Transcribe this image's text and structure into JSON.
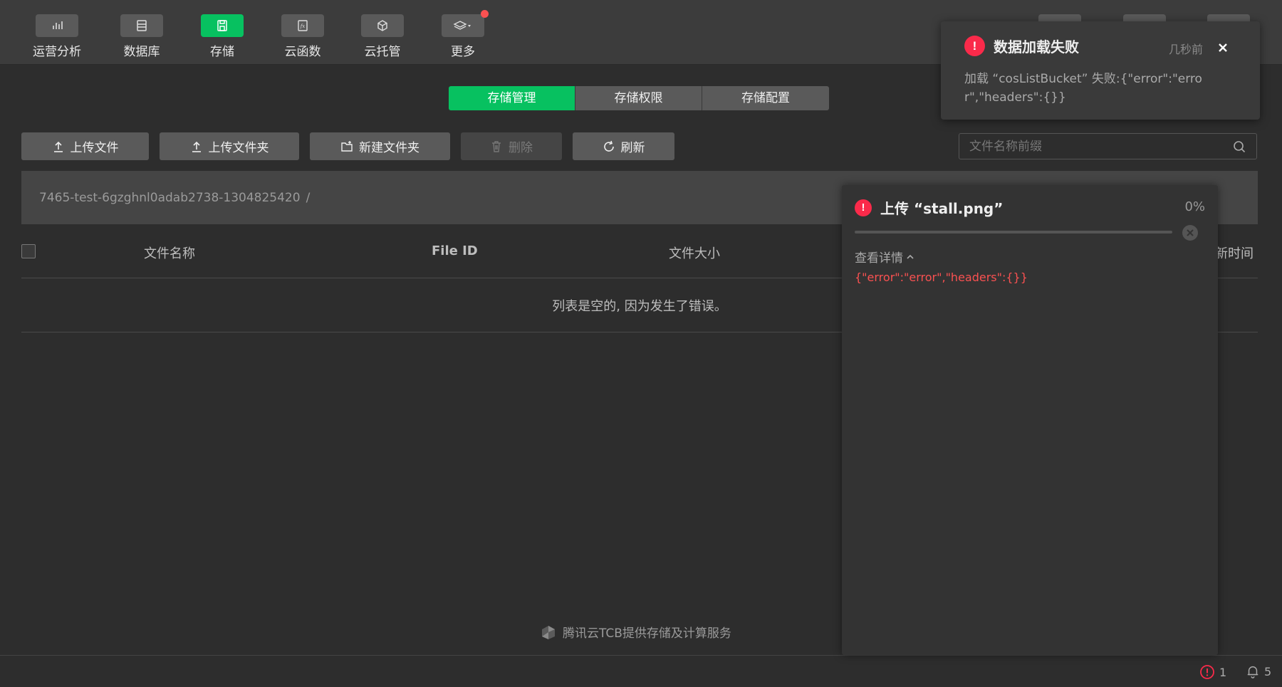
{
  "nav": {
    "items": [
      {
        "label": "运营分析",
        "icon": "bar-chart-icon",
        "active": false
      },
      {
        "label": "数据库",
        "icon": "database-icon",
        "active": false
      },
      {
        "label": "存储",
        "icon": "save-icon",
        "active": true
      },
      {
        "label": "云函数",
        "icon": "function-icon",
        "active": false
      },
      {
        "label": "云托管",
        "icon": "cube-icon",
        "active": false
      },
      {
        "label": "更多",
        "icon": "layers-icon",
        "active": false
      }
    ]
  },
  "tabs": [
    {
      "label": "存储管理",
      "active": true
    },
    {
      "label": "存储权限",
      "active": false
    },
    {
      "label": "存储配置",
      "active": false
    }
  ],
  "toolbar": {
    "upload_file": "上传文件",
    "upload_folder": "上传文件夹",
    "new_folder": "新建文件夹",
    "delete": "删除",
    "refresh": "刷新"
  },
  "search": {
    "placeholder": "文件名称前缀"
  },
  "path": {
    "bucket": "7465-test-6gzghnl0adab2738-1304825420",
    "separator": "/"
  },
  "table": {
    "columns": [
      "文件名称",
      "File ID",
      "文件大小",
      "新时间"
    ],
    "empty_message": "列表是空的, 因为发生了错误。"
  },
  "footer": {
    "brand": "腾讯云TCB提供存储及计算服务"
  },
  "status": {
    "errors": "1",
    "notifications": "5"
  },
  "upload": {
    "title": "上传 “stall.png”",
    "percent": "0%",
    "progress": 0,
    "details_label": "查看详情",
    "details_text": "{\"error\":\"error\",\"headers\":{}}"
  },
  "toast": {
    "title": "数据加载失败",
    "time": "几秒前",
    "message": "加载 “cosListBucket” 失败:{\"error\":\"error\",\"headers\":{}}"
  },
  "colors": {
    "accent": "#07c160",
    "error": "#fa2a4a",
    "error_text": "#fa5151"
  }
}
